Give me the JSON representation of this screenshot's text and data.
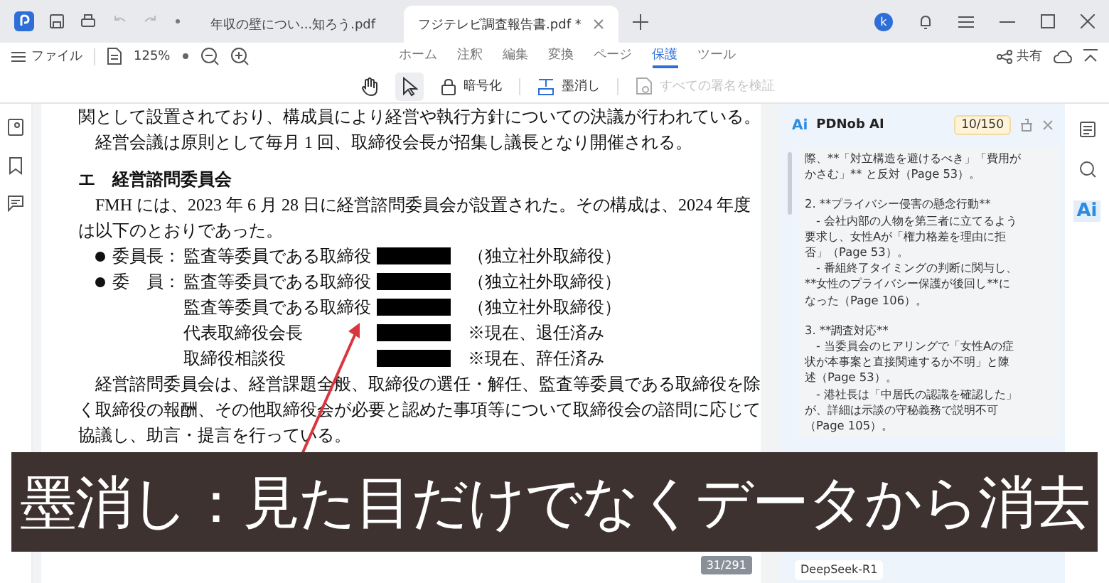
{
  "titlebar": {
    "tabs": [
      {
        "label": "年収の壁につい...知ろう.pdf",
        "selected": false
      },
      {
        "label": "フジテレビ調査報告書.pdf *",
        "selected": true
      }
    ],
    "avatar": "k"
  },
  "toolbar": {
    "file_menu": "ファイル",
    "zoom": "125%",
    "ribbon_tabs": [
      {
        "label": "ホーム",
        "selected": false
      },
      {
        "label": "注釈",
        "selected": false
      },
      {
        "label": "編集",
        "selected": false
      },
      {
        "label": "変換",
        "selected": false
      },
      {
        "label": "ページ",
        "selected": false
      },
      {
        "label": "保護",
        "selected": true
      },
      {
        "label": "ツール",
        "selected": false
      }
    ],
    "share": "共有"
  },
  "tools": {
    "pointer": [
      {
        "kind": "hand",
        "selected": false
      },
      {
        "kind": "select",
        "selected": true
      }
    ],
    "protect": [
      {
        "kind": "lock",
        "label": "暗号化",
        "disabled": false
      },
      {
        "kind": "redact",
        "label": "墨消し",
        "disabled": false
      },
      {
        "kind": "verify",
        "label": "すべての署名を検証",
        "disabled": true
      }
    ]
  },
  "document": {
    "blocks": [
      {
        "kind": "line",
        "text": "関として設置されており、構成員により経営や執行方針についての決議が行われている。",
        "indent": false
      },
      {
        "kind": "line",
        "text": "経営会議は原則として毎月 1 回、取締役会長が招集し議長となり開催される。",
        "indent": true
      },
      {
        "kind": "heading",
        "text": "エ　経営諮問委員会"
      },
      {
        "kind": "line",
        "text": "FMH には、2023 年 6 月 28 日に経営諮問委員会が設置された。その構成は、2024 年度",
        "indent": true
      },
      {
        "kind": "line",
        "text": "は以下のとおりであった。",
        "indent": false
      },
      {
        "kind": "member",
        "bullet": true,
        "role": "委員長：",
        "position": "監査等委員である取締役",
        "note": "（独立社外取締役）"
      },
      {
        "kind": "member",
        "bullet": true,
        "role": "委　員：",
        "position": "監査等委員である取締役",
        "note": "（独立社外取締役）"
      },
      {
        "kind": "member",
        "bullet": false,
        "position": "監査等委員である取締役",
        "note": "（独立社外取締役）"
      },
      {
        "kind": "member",
        "bullet": false,
        "position": "代表取締役会長",
        "note": "※現在、退任済み"
      },
      {
        "kind": "member",
        "bullet": false,
        "position": "取締役相談役",
        "note": "※現在、辞任済み"
      },
      {
        "kind": "line",
        "text": "経営諮問委員会は、経営課題全般、取締役の選任・解任、監査等委員である取締役を除",
        "indent": true
      },
      {
        "kind": "line",
        "text": "く取締役の報酬、その他取締役会が必要と認めた事項等について取締役会の諮問に応じて",
        "indent": false
      },
      {
        "kind": "line",
        "text": "協議し、助言・提言を行っている。",
        "indent": false
      }
    ],
    "page_counter": "31/291"
  },
  "ai_panel": {
    "logo": "Ai",
    "title": "PDNob AI",
    "quota": "10/150",
    "message": [
      [
        "際、**「対立構造を避けるべき」「費用が",
        "かさむ」** と反対（Page 53）。"
      ],
      [
        "2. **プライバシー侵害の懸念行動**",
        "　- 会社内部の人物を第三者に立てるよう",
        "要求し、女性Aが「権力格差を理由に拒",
        "否」（Page 53）。",
        "　- 番組終了タイミングの判断に関与し、",
        "**女性のプライバシー保護が後回し**に",
        "なった（Page 106）。"
      ],
      [
        "3. **調査対応**",
        "　- 当委員会のヒアリングで「女性Aの症",
        "状が本事案と直接関連するか不明」と陳",
        "述（Page 53）。",
        "　- 港社長は「中居氏の認識を確認した」",
        "が、詳細は示談の守秘義務で説明不可",
        "（Page 105）。"
      ]
    ],
    "model": "DeepSeek-R1"
  },
  "right_rail": {
    "ai_label": "Ai"
  },
  "caption": "墨消し：見た目だけでなくデータから消去"
}
